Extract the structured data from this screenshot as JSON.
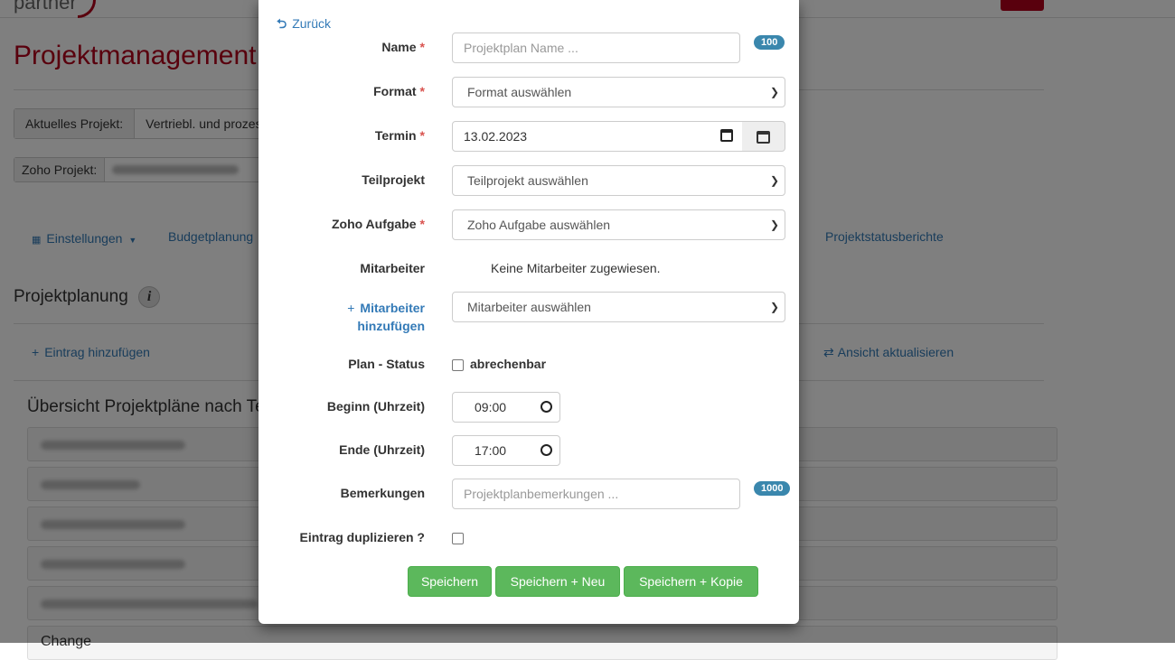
{
  "background": {
    "logo_text": "partner",
    "page_title": "Projektmanagement",
    "current_project_label": "Aktuelles Projekt:",
    "current_project_value": "Vertriebl. und prozess",
    "zoho_project_label": "Zoho Projekt:",
    "nav": {
      "settings": "Einstellungen",
      "budget": "Budgetplanung",
      "status_reports": "Projektstatusberichte"
    },
    "section_title": "Projektplanung",
    "add_entry": "Eintrag hinzufügen",
    "refresh_view": "Ansicht aktualisieren",
    "overview_title": "Übersicht Projektpläne nach Te",
    "last_panel": "Change"
  },
  "modal": {
    "back_label": "Zurück",
    "name": {
      "label": "Name",
      "placeholder": "Projektplan Name ...",
      "counter": "100"
    },
    "format": {
      "label": "Format",
      "selected": "Format auswählen"
    },
    "termin": {
      "label": "Termin",
      "value": "13.02.2023"
    },
    "teilprojekt": {
      "label": "Teilprojekt",
      "selected": "Teilprojekt auswählen"
    },
    "zoho_aufgabe": {
      "label": "Zoho Aufgabe",
      "selected": "Zoho Aufgabe auswählen"
    },
    "mitarbeiter": {
      "label": "Mitarbeiter",
      "value": "Keine Mitarbeiter zugewiesen."
    },
    "add_mitarbeiter": {
      "label_line1": "Mitarbeiter",
      "label_line2": "hinzufügen",
      "selected": "Mitarbeiter auswählen"
    },
    "plan_status": {
      "label": "Plan - Status",
      "checkbox_label": "abrechenbar",
      "checked": false
    },
    "beginn": {
      "label": "Beginn (Uhrzeit)",
      "value": "09:00"
    },
    "ende": {
      "label": "Ende (Uhrzeit)",
      "value": "17:00"
    },
    "bemerkungen": {
      "label": "Bemerkungen",
      "placeholder": "Projektplanbemerkungen ...",
      "counter": "1000"
    },
    "duplizieren": {
      "label": "Eintrag duplizieren ?",
      "checked": false
    },
    "buttons": {
      "save": "Speichern",
      "save_new": "Speichern + Neu",
      "save_copy": "Speichern + Kopie"
    }
  },
  "colors": {
    "brand_red": "#b3001b",
    "link_blue": "#337ab7",
    "badge_blue": "#3a87ad",
    "success_green": "#5cb85c",
    "required_red": "#d9534f"
  }
}
